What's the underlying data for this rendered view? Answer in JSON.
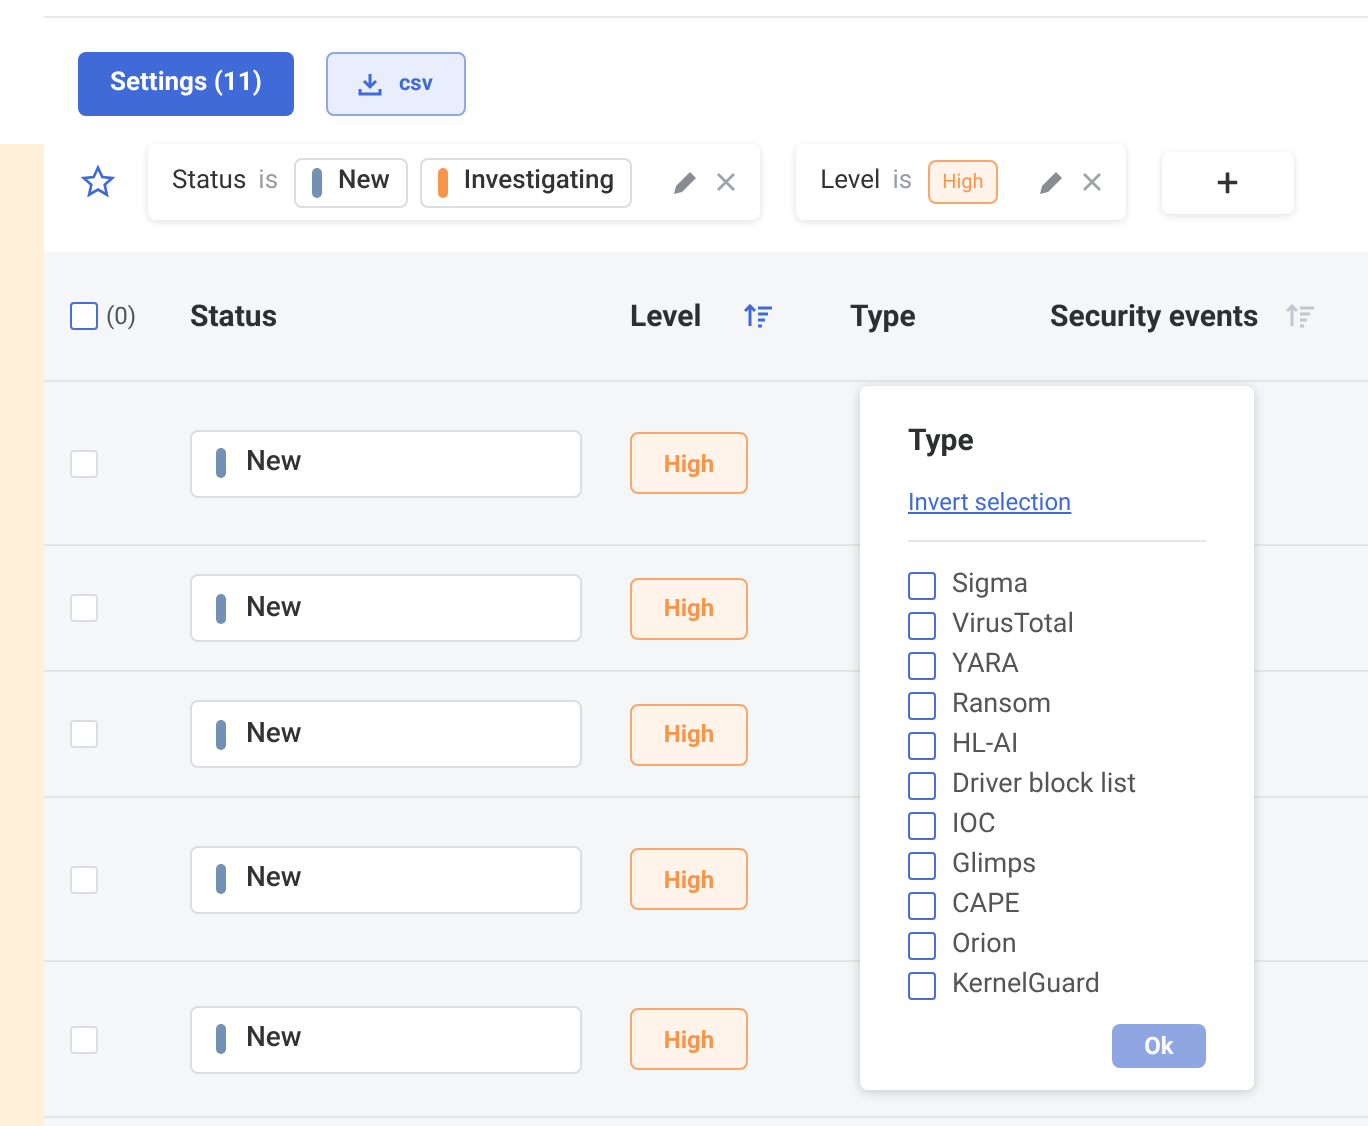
{
  "toolbar": {
    "settings_button": "Settings (11)",
    "csv_button": "csv"
  },
  "filters": [
    {
      "field": "Status",
      "operator": "is",
      "values": [
        {
          "label": "New",
          "color": "#7391b4"
        },
        {
          "label": "Investigating",
          "color": "#f7964b"
        }
      ]
    },
    {
      "field": "Level",
      "operator": "is",
      "values": [
        {
          "label": "High",
          "kind": "level"
        }
      ]
    }
  ],
  "add_filter": "+",
  "table": {
    "selection_count": "(0)",
    "select_all_checked": false,
    "columns": [
      {
        "label": "Status",
        "sortable": false
      },
      {
        "label": "Level",
        "sortable": true,
        "sorted": true
      },
      {
        "label": "Type",
        "sortable": false
      },
      {
        "label": "Security events",
        "sortable": true,
        "sorted": false
      }
    ],
    "rows": [
      {
        "checked": false,
        "status": "New",
        "color": "#7391b4",
        "level": "High"
      },
      {
        "checked": false,
        "status": "New",
        "color": "#7391b4",
        "level": "High"
      },
      {
        "checked": false,
        "status": "New",
        "color": "#7391b4",
        "level": "High"
      },
      {
        "checked": false,
        "status": "New",
        "color": "#7391b4",
        "level": "High"
      },
      {
        "checked": false,
        "status": "New",
        "color": "#7391b4",
        "level": "High"
      }
    ]
  },
  "type_popover": {
    "title": "Type",
    "invert_link": "Invert selection",
    "ok_button": "Ok",
    "options": [
      {
        "label": "Sigma",
        "checked": false
      },
      {
        "label": "VirusTotal",
        "checked": false
      },
      {
        "label": "YARA",
        "checked": false
      },
      {
        "label": "Ransom",
        "checked": false
      },
      {
        "label": "HL-AI",
        "checked": false
      },
      {
        "label": "Driver block list",
        "checked": false
      },
      {
        "label": "IOC",
        "checked": false
      },
      {
        "label": "Glimps",
        "checked": false
      },
      {
        "label": "CAPE",
        "checked": false
      },
      {
        "label": "Orion",
        "checked": false
      },
      {
        "label": "KernelGuard",
        "checked": false
      }
    ]
  }
}
